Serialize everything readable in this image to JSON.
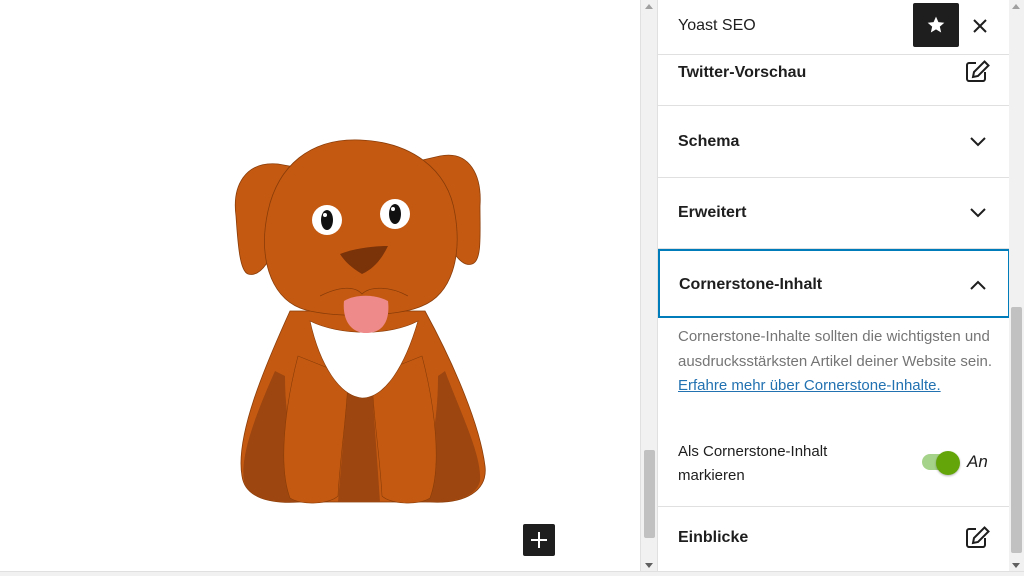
{
  "sidebar": {
    "title": "Yoast SEO",
    "star_icon": "star-icon",
    "close_icon": "close-icon",
    "panels": {
      "twitter": {
        "label": "Twitter-Vorschau",
        "icon": "edit-icon"
      },
      "schema": {
        "label": "Schema",
        "icon": "chevron-down-icon"
      },
      "erweitert": {
        "label": "Erweitert",
        "icon": "chevron-down-icon"
      },
      "cornerstone": {
        "label": "Cornerstone-Inhalt",
        "icon": "chevron-up-icon",
        "description": "Cornerstone-Inhalte sollten die wichtigsten und ausdrucksstärksten Artikel deiner Website sein.",
        "link_text": "Erfahre mehr über Cornerstone-Inhalte.",
        "toggle_label": "Als Cornerstone-Inhalt markieren",
        "toggle_state": "An",
        "toggle_on": true
      },
      "einblicke": {
        "label": "Einblicke",
        "icon": "edit-icon"
      }
    }
  },
  "editor": {
    "image": "dog-illustration",
    "add_block_icon": "plus-icon"
  },
  "colors": {
    "accent": "#007cba",
    "link": "#2271b1",
    "toggle_on": "#64a60a",
    "dark_button": "#1e1e1e"
  }
}
